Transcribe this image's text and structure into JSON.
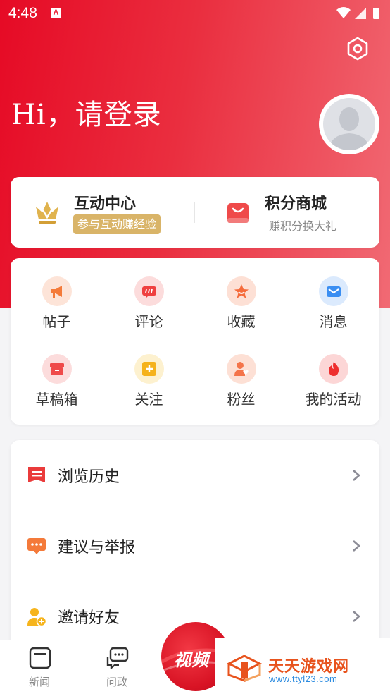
{
  "status_bar": {
    "time": "4:48",
    "notification_glyph": "A"
  },
  "header": {
    "greeting": "Hi，请登录"
  },
  "top_card": {
    "left": {
      "title": "互动中心",
      "badge": "参与互动赚经验",
      "icon": "crown-icon"
    },
    "right": {
      "title": "积分商城",
      "subtitle": "赚积分换大礼",
      "icon": "shopping-bag-icon"
    }
  },
  "grid": [
    {
      "label": "帖子",
      "icon": "megaphone-icon",
      "color": "#f47b3a"
    },
    {
      "label": "评论",
      "icon": "comment-icon",
      "color": "#ef3f3f"
    },
    {
      "label": "收藏",
      "icon": "star-icon",
      "color": "#f56b3b"
    },
    {
      "label": "消息",
      "icon": "mail-icon",
      "color": "#3a8ef2"
    },
    {
      "label": "草稿箱",
      "icon": "draft-box-icon",
      "color": "#ef4a4a"
    },
    {
      "label": "关注",
      "icon": "plus-square-icon",
      "color": "#f5b21b"
    },
    {
      "label": "粉丝",
      "icon": "fans-icon",
      "color": "#f4744a"
    },
    {
      "label": "我的活动",
      "icon": "flame-icon",
      "color": "#ee2e2e"
    }
  ],
  "list": [
    {
      "label": "浏览历史",
      "icon": "history-icon",
      "color": "#ea3b3b"
    },
    {
      "label": "建议与举报",
      "icon": "feedback-icon",
      "color": "#f47a3a"
    },
    {
      "label": "邀请好友",
      "icon": "invite-user-icon",
      "color": "#f6b41c"
    }
  ],
  "bottom_nav": [
    {
      "label": "新闻",
      "icon": "news-icon"
    },
    {
      "label": "问政",
      "icon": "inquiry-icon"
    }
  ],
  "video_button": {
    "label": "视频"
  },
  "watermark": {
    "title": "天天游戏网",
    "url": "www.ttyl23.com"
  },
  "colors": {
    "brand_red": "#e60a25",
    "gold": "#d9b468"
  }
}
